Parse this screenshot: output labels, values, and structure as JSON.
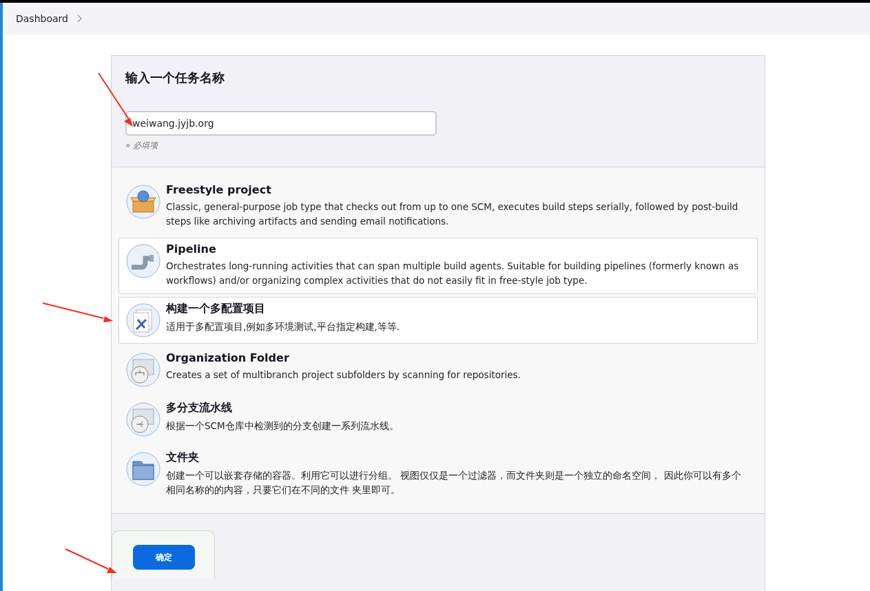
{
  "breadcrumb": {
    "items": [
      "Dashboard"
    ]
  },
  "name_section": {
    "title": "输入一个任务名称",
    "input_value": "weiwang.jyjb.org",
    "hint": "» 必填项"
  },
  "job_types": [
    {
      "kind": "freestyle",
      "title": "Freestyle project",
      "description": "Classic, general-purpose job type that checks out from up to one SCM, executes build steps serially, followed by post-build steps like archiving artifacts and sending email notifications.",
      "highlighted": false
    },
    {
      "kind": "pipeline",
      "title": "Pipeline",
      "description": "Orchestrates long-running activities that can span multiple build agents. Suitable for building pipelines (formerly known as workflows) and/or organizing complex activities that do not easily fit in free-style job type.",
      "highlighted": true
    },
    {
      "kind": "multiconfig",
      "title": "构建一个多配置项目",
      "description": "适用于多配置项目,例如多环境测试,平台指定构建,等等.",
      "highlighted": true
    },
    {
      "kind": "orgfolder",
      "title": "Organization Folder",
      "description": "Creates a set of multibranch project subfolders by scanning for repositories.",
      "highlighted": false
    },
    {
      "kind": "multibranch",
      "title": "多分支流水线",
      "description": "根据一个SCM仓库中检测到的分支创建一系列流水线。",
      "highlighted": false
    },
    {
      "kind": "folder",
      "title": "文件夹",
      "description": "创建一个可以嵌套存储的容器。利用它可以进行分组。 视图仅仅是一个过滤器，而文件夹则是一个独立的命名空间， 因此你可以有多个相同名称的的内容，只要它们在不同的文件 夹里即可。",
      "highlighted": false
    }
  ],
  "ok_button": "确定"
}
